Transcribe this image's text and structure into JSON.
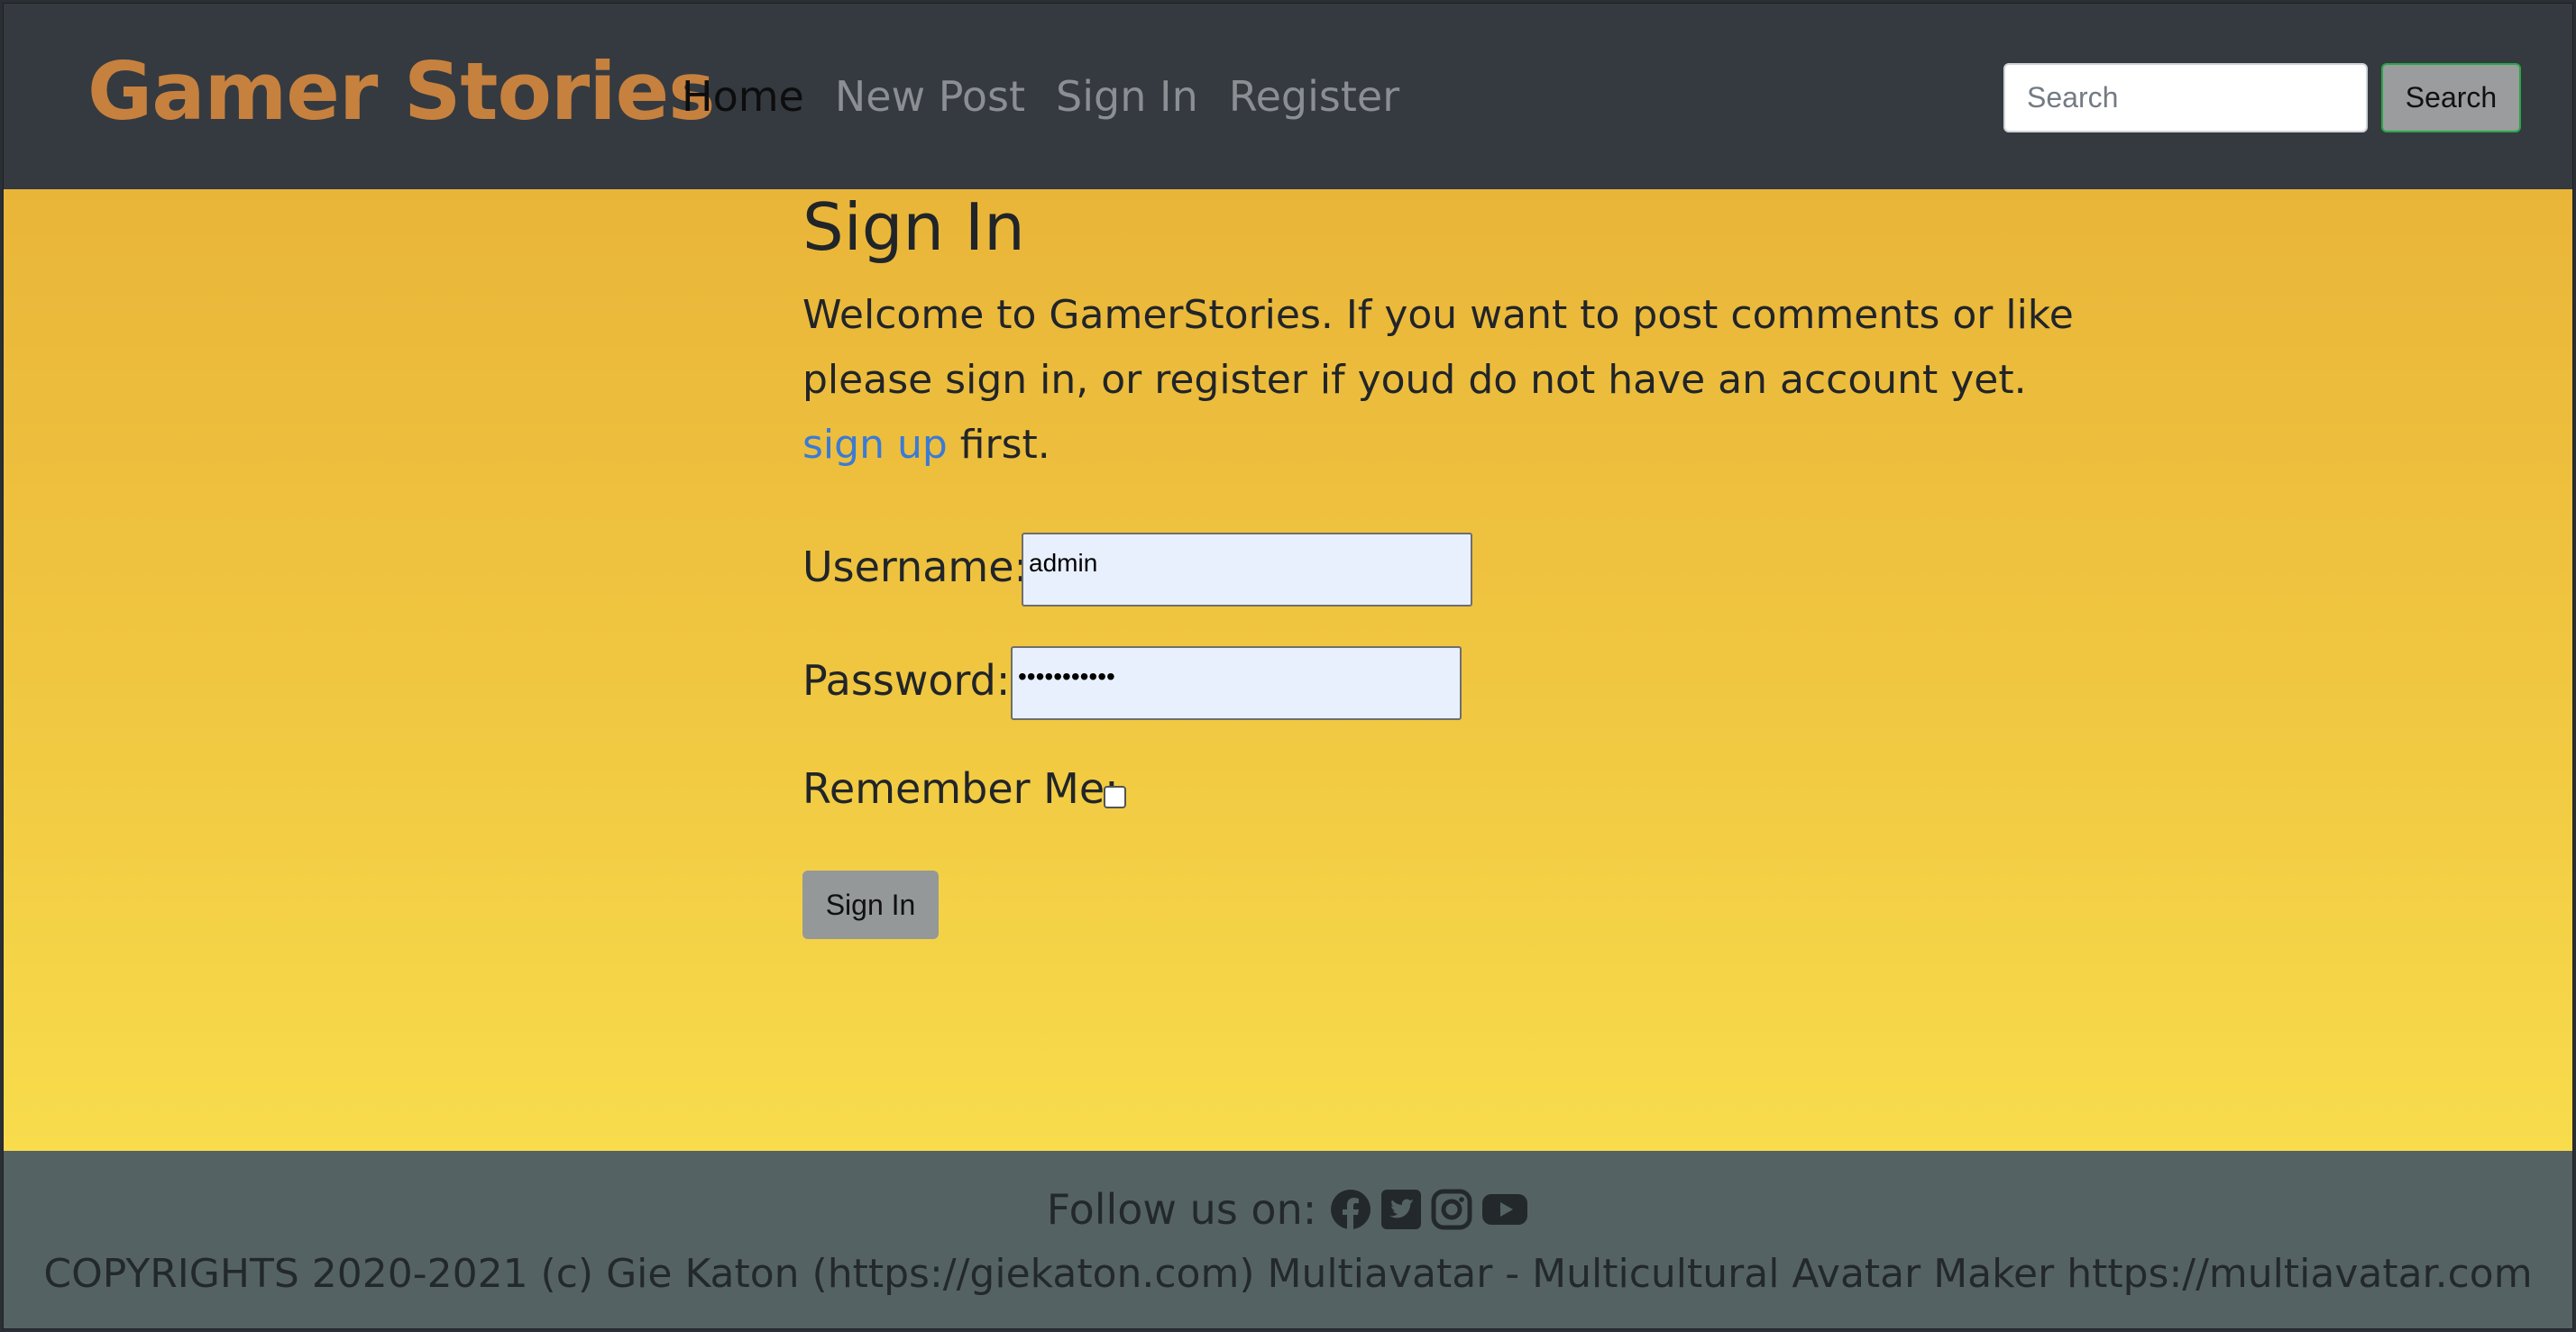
{
  "navbar": {
    "brand": "Gamer Stories",
    "links": [
      {
        "label": "Home",
        "active": true
      },
      {
        "label": "New Post",
        "active": false
      },
      {
        "label": "Sign In",
        "active": false
      },
      {
        "label": "Register",
        "active": false
      }
    ],
    "search": {
      "placeholder": "Search",
      "button_label": "Search"
    }
  },
  "main": {
    "title": "Sign In",
    "intro": "Welcome to GamerStories. If you want to post comments or like please sign in, or register if youd do not have an account yet.",
    "signup_link": "sign up",
    "intro_end": "first.",
    "form": {
      "username_label": "Username:",
      "username_value": "admin",
      "password_label": "Password:",
      "password_value": "•••••••••••",
      "remember_label": "Remember Me:",
      "remember_checked": false,
      "submit_label": "Sign In"
    }
  },
  "footer": {
    "follow_label": "Follow us on:",
    "social_icons": [
      "facebook-icon",
      "twitter-icon",
      "instagram-icon",
      "youtube-icon"
    ],
    "copyright": "COPYRIGHTS 2020-2021 (c) Gie Katon (https://giekaton.com) Multiavatar - Multicultural Avatar Maker https://multiavatar.com"
  },
  "colors": {
    "navbar_bg": "#343a40",
    "brand": "#c6813f",
    "main_gradient_top": "#e9b539",
    "main_gradient_bottom": "#f8dc4c",
    "footer_bg": "#556264",
    "link": "#3a7bd5"
  }
}
